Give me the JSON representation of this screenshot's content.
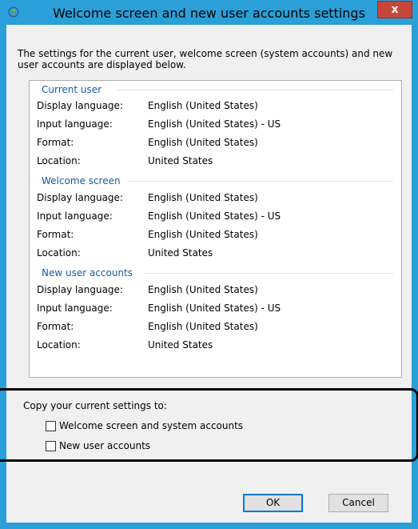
{
  "window": {
    "title": "Welcome screen and new user accounts settings",
    "close_label": "x"
  },
  "intro_text": "The settings for the current user, welcome screen (system accounts) and new user accounts are displayed below.",
  "groups": [
    {
      "header": "Current user",
      "rows": [
        {
          "label": "Display language:",
          "value": "English (United States)"
        },
        {
          "label": "Input language:",
          "value": "English (United States) - US"
        },
        {
          "label": "Format:",
          "value": "English (United States)"
        },
        {
          "label": "Location:",
          "value": "United States"
        }
      ]
    },
    {
      "header": "Welcome screen",
      "rows": [
        {
          "label": "Display language:",
          "value": "English (United States)"
        },
        {
          "label": "Input language:",
          "value": "English (United States) - US"
        },
        {
          "label": "Format:",
          "value": "English (United States)"
        },
        {
          "label": "Location:",
          "value": "United States"
        }
      ]
    },
    {
      "header": "New user accounts",
      "rows": [
        {
          "label": "Display language:",
          "value": "English (United States)"
        },
        {
          "label": "Input language:",
          "value": "English (United States) - US"
        },
        {
          "label": "Format:",
          "value": "English (United States)"
        },
        {
          "label": "Location:",
          "value": "United States"
        }
      ]
    }
  ],
  "copy": {
    "label": "Copy your current settings to:",
    "options": [
      {
        "label": "Welcome screen and system accounts",
        "checked": false
      },
      {
        "label": "New user accounts",
        "checked": false
      }
    ]
  },
  "buttons": {
    "ok": "OK",
    "cancel": "Cancel"
  },
  "colors": {
    "titlebar": "#2a9fd8",
    "close": "#c7463a",
    "group_header": "#1a5aa6"
  }
}
